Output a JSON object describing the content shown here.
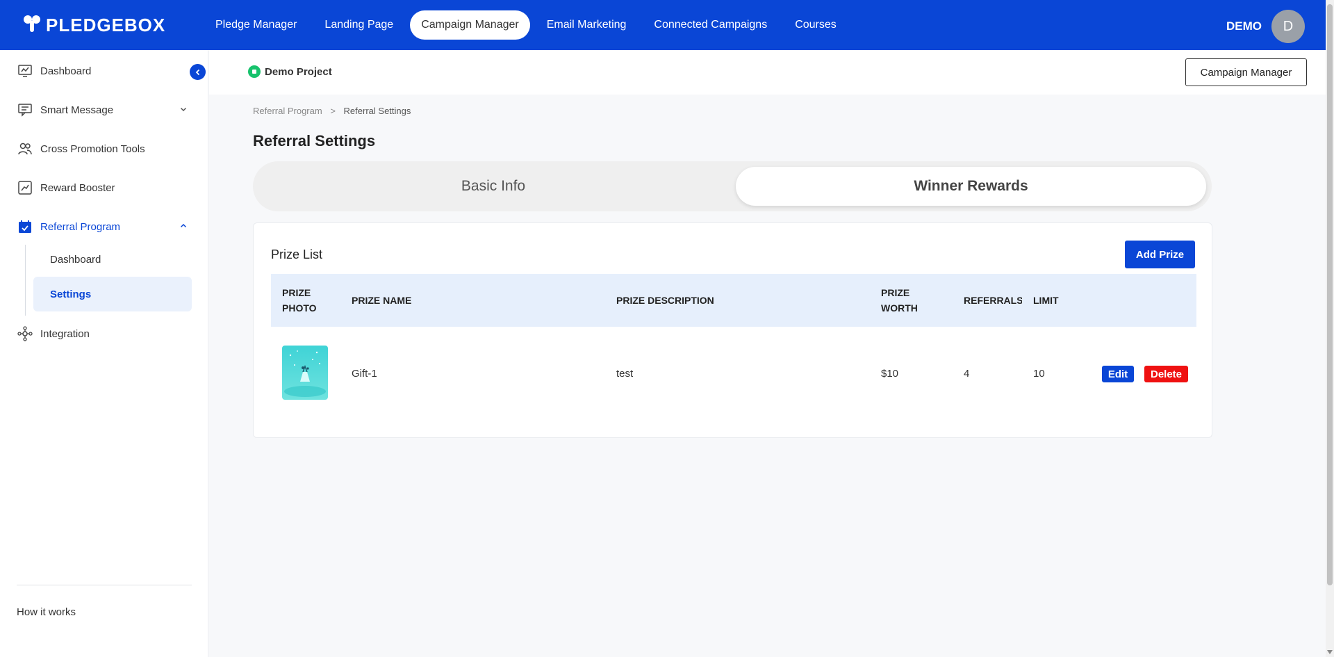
{
  "brand": {
    "name": "PLEDGEBOX"
  },
  "nav": {
    "items": [
      {
        "label": "Pledge Manager"
      },
      {
        "label": "Landing Page"
      },
      {
        "label": "Campaign Manager",
        "active": true
      },
      {
        "label": "Email Marketing"
      },
      {
        "label": "Connected Campaigns"
      },
      {
        "label": "Courses"
      }
    ]
  },
  "user": {
    "name": "DEMO",
    "initial": "D"
  },
  "sidebar": {
    "items": [
      {
        "label": "Dashboard",
        "icon": "dashboard-icon"
      },
      {
        "label": "Smart Message",
        "icon": "message-icon"
      },
      {
        "label": "Cross Promotion Tools",
        "icon": "users-icon"
      },
      {
        "label": "Reward Booster",
        "icon": "chart-icon"
      },
      {
        "label": "Referral Program",
        "icon": "calendar-icon"
      },
      {
        "label": "Integration",
        "icon": "integration-icon"
      }
    ],
    "sub_items": [
      {
        "label": "Dashboard"
      },
      {
        "label": "Settings",
        "active": true
      }
    ],
    "footer": "How it works"
  },
  "project": {
    "name": "Demo Project",
    "button": "Campaign Manager"
  },
  "breadcrumb": {
    "parent": "Referral Program",
    "separator": ">",
    "current": "Referral Settings"
  },
  "page": {
    "title": "Referral Settings"
  },
  "tabs": [
    {
      "label": "Basic Info"
    },
    {
      "label": "Winner Rewards",
      "active": true
    }
  ],
  "prize_list": {
    "title": "Prize List",
    "add_button": "Add Prize",
    "columns": {
      "photo_1": "PRIZE",
      "photo_2": "PHOTO",
      "name": "PRIZE NAME",
      "description": "PRIZE DESCRIPTION",
      "worth_1": "PRIZE",
      "worth_2": "WORTH",
      "referrals": "REFERRALS",
      "limit": "LIMIT"
    },
    "rows": [
      {
        "name": "Gift-1",
        "description": "test",
        "worth": "$10",
        "referrals": "4",
        "limit": "10",
        "edit": "Edit",
        "delete": "Delete"
      }
    ]
  },
  "colors": {
    "primary": "#0a46d6",
    "danger": "#ef1111",
    "success": "#16c26c",
    "header_row": "#e6effc"
  }
}
